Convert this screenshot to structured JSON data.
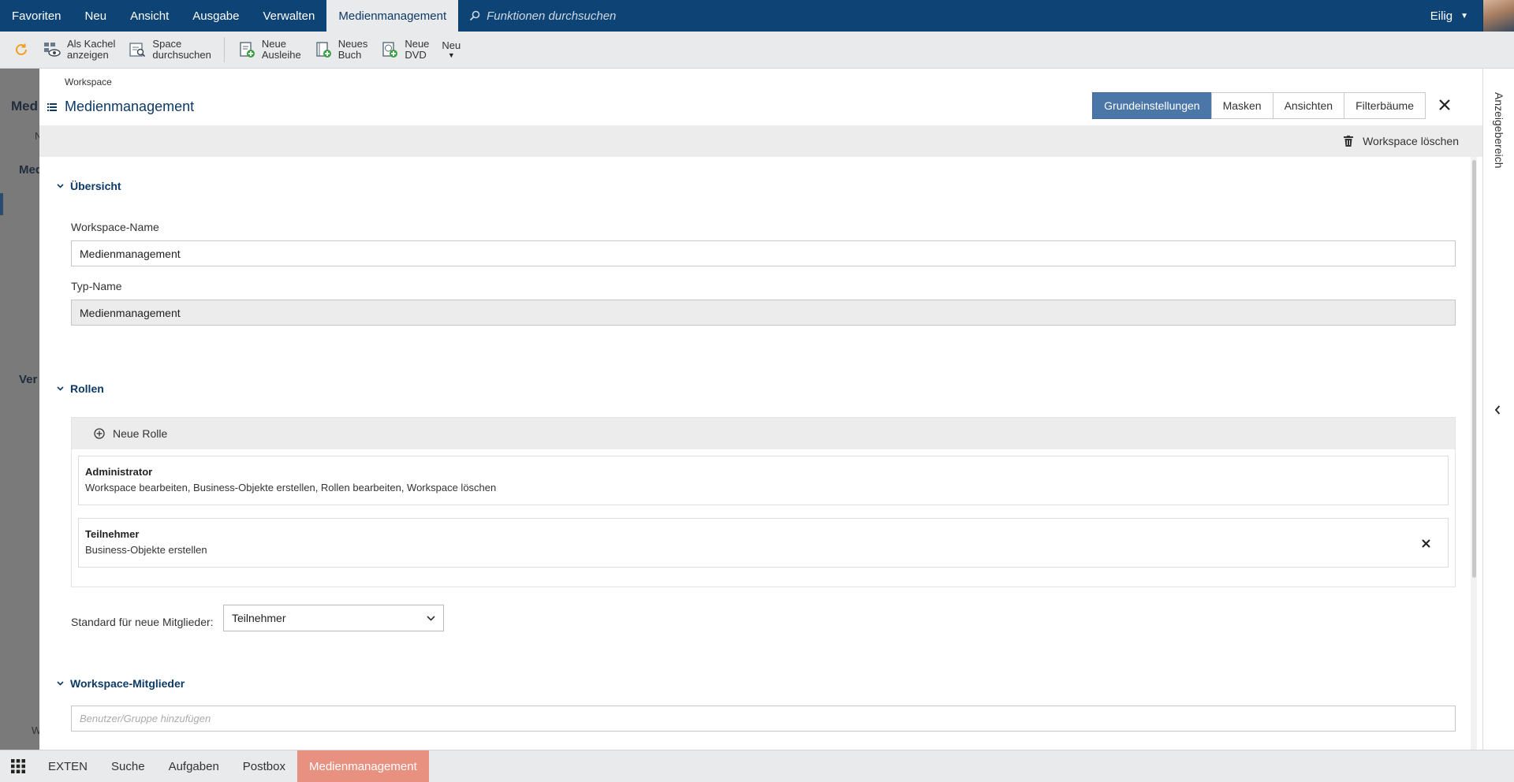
{
  "topnav": {
    "tabs": [
      "Favoriten",
      "Neu",
      "Ansicht",
      "Ausgabe",
      "Verwalten",
      "Medienmanagement"
    ],
    "active_index": 5,
    "search_placeholder": "Funktionen durchsuchen",
    "user": "Eilig"
  },
  "toolbar": {
    "refresh_icon": "refresh-icon",
    "items": [
      {
        "label": "Als Kachel\nanzeigen",
        "icon": "tile-view-icon"
      },
      {
        "label": "Space\ndurchsuchen",
        "icon": "space-search-icon"
      },
      {
        "label": "Neue\nAusleihe",
        "icon": "new-loan-icon"
      },
      {
        "label": "Neues\nBuch",
        "icon": "new-book-icon"
      },
      {
        "label": "Neue\nDVD",
        "icon": "new-dvd-icon"
      },
      {
        "label": "Neu",
        "icon": "chevron-down-icon"
      }
    ]
  },
  "colors": {
    "nav_bg": "#0d4475",
    "accent": "#4a76a8",
    "bottom_active": "#e99181",
    "title": "#0d3a66"
  },
  "panel": {
    "breadcrumb": "Workspace",
    "title": "Medienmanagement",
    "tabs": [
      "Grundeinstellungen",
      "Masken",
      "Ansichten",
      "Filterbäume"
    ],
    "active_tab": 0,
    "delete_label": "Workspace löschen"
  },
  "overview": {
    "heading": "Übersicht",
    "workspace_name_label": "Workspace-Name",
    "workspace_name_value": "Medienmanagement",
    "type_name_label": "Typ-Name",
    "type_name_value": "Medienmanagement"
  },
  "roles": {
    "heading": "Rollen",
    "new_role_label": "Neue Rolle",
    "items": [
      {
        "name": "Administrator",
        "permissions": "Workspace bearbeiten, Business-Objekte erstellen, Rollen bearbeiten, Workspace löschen",
        "removable": false
      },
      {
        "name": "Teilnehmer",
        "permissions": "Business-Objekte erstellen",
        "removable": true
      }
    ],
    "default_label": "Standard für neue Mitglieder:",
    "default_value": "Teilnehmer"
  },
  "members": {
    "heading": "Workspace-Mitglieder",
    "add_placeholder": "Benutzer/Gruppe hinzufügen"
  },
  "rail": {
    "label": "Anzeigebereich"
  },
  "background": {
    "labels": [
      "Med",
      "N",
      "Med",
      "Ver",
      "W"
    ]
  },
  "bottombar": {
    "tabs": [
      "EXTEN",
      "Suche",
      "Aufgaben",
      "Postbox",
      "Medienmanagement"
    ],
    "active_index": 4
  }
}
